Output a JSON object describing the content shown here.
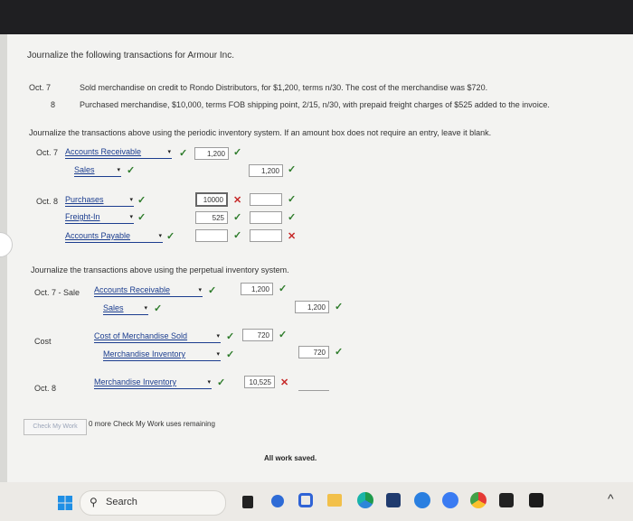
{
  "instructions": "Journalize the following transactions for Armour Inc.",
  "transactions": [
    {
      "date": "Oct. 7",
      "desc": "Sold merchandise on credit to Rondo Distributors, for $1,200, terms n/30. The cost of the merchandise was $720."
    },
    {
      "date": "8",
      "desc": "Purchased merchandise, $10,000, terms FOB shipping point, 2/15, n/30, with prepaid freight charges of $525 added to the invoice."
    }
  ],
  "periodic_instructions": "Journalize the transactions above using the periodic inventory system. If an amount box does not require an entry, leave it blank.",
  "periodic": {
    "oct7_date": "Oct. 7",
    "oct7_row1_account": "Accounts Receivable",
    "oct7_row1_debit": "1,200",
    "oct7_row2_account": "Sales",
    "oct7_row2_credit": "1,200",
    "oct8_date": "Oct. 8",
    "oct8_row1_account": "Purchases",
    "oct8_row1_debit": "10000",
    "oct8_row2_account": "Freight-In",
    "oct8_row2_debit": "525",
    "oct8_row3_account": "Accounts Payable"
  },
  "perpetual_instructions": "Journalize the transactions above using the perpetual inventory system.",
  "perpetual": {
    "oct7_label": "Oct. 7 - Sale",
    "oct7_row1_account": "Accounts Receivable",
    "oct7_row1_debit": "1,200",
    "oct7_row2_account": "Sales",
    "oct7_row2_credit": "1,200",
    "cost_label": "Cost",
    "cost_row1_account": "Cost of Merchandise Sold",
    "cost_row1_debit": "720",
    "cost_row2_account": "Merchandise Inventory",
    "cost_row2_credit": "720",
    "oct8_label": "Oct. 8",
    "oct8_row1_account": "Merchandise Inventory",
    "oct8_row1_debit": "10,525"
  },
  "check_button": "Check My Work",
  "check_remaining": "0 more Check My Work uses remaining",
  "saved_status": "All work saved.",
  "taskbar": {
    "search_label": "Search"
  },
  "marks": {
    "check": "✓",
    "cross": "✕",
    "dropdown": "▾"
  },
  "colors": {
    "link": "#1b3d8f",
    "correct": "#2d7b2a",
    "incorrect": "#c62828"
  }
}
